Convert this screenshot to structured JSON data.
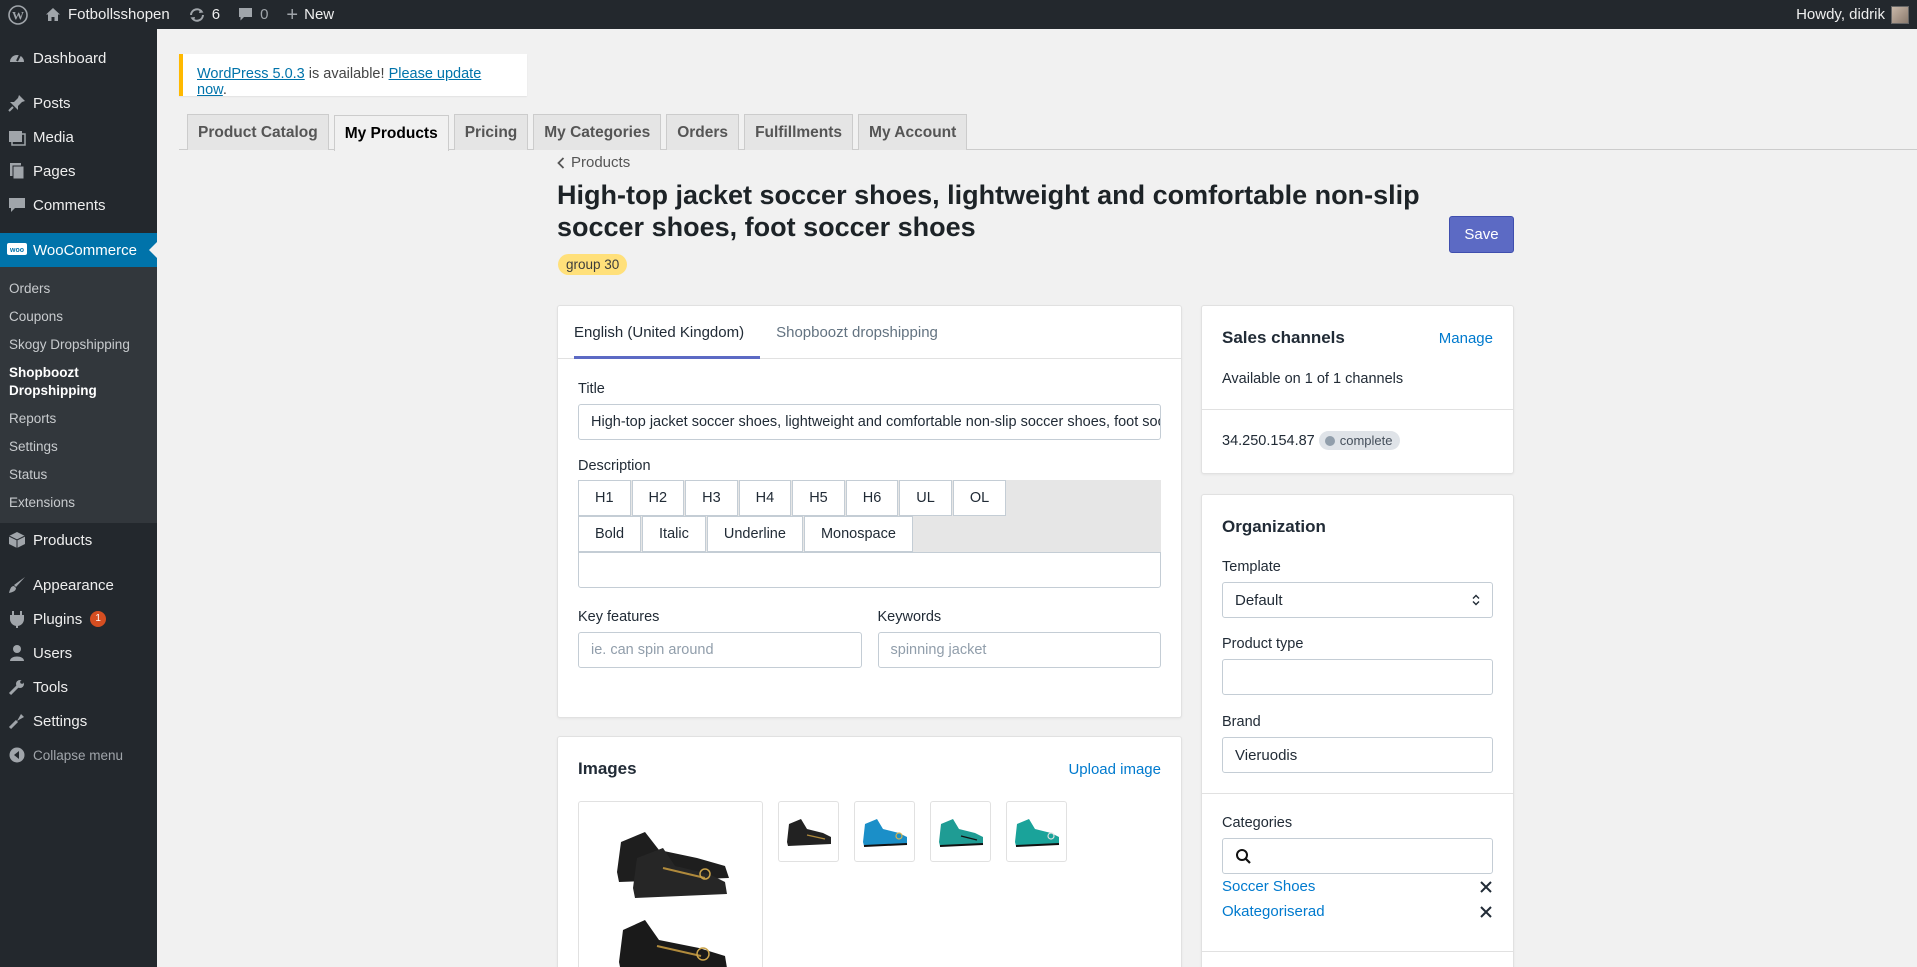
{
  "adminbar": {
    "site_name": "Fotbollsshopen",
    "updates_count": "6",
    "comments_count": "0",
    "new_label": "New",
    "greeting": "Howdy, didrik"
  },
  "sidebar": {
    "items": [
      {
        "label": "Dashboard",
        "icon": "dashboard-icon"
      },
      {
        "label": "Posts",
        "icon": "pin-icon"
      },
      {
        "label": "Media",
        "icon": "media-icon"
      },
      {
        "label": "Pages",
        "icon": "pages-icon"
      },
      {
        "label": "Comments",
        "icon": "comment-icon"
      },
      {
        "label": "WooCommerce",
        "icon": "woo-icon"
      }
    ],
    "woo_submenu": [
      "Orders",
      "Coupons",
      "Skogy Dropshipping",
      "Shopboozt Dropshipping",
      "Reports",
      "Settings",
      "Status",
      "Extensions"
    ],
    "items_after": [
      {
        "label": "Products",
        "icon": "products-icon"
      },
      {
        "label": "Appearance",
        "icon": "brush-icon"
      },
      {
        "label": "Plugins",
        "icon": "plugin-icon",
        "badge": "1"
      },
      {
        "label": "Users",
        "icon": "user-icon"
      },
      {
        "label": "Tools",
        "icon": "wrench-icon"
      },
      {
        "label": "Settings",
        "icon": "settings-icon"
      }
    ],
    "collapse_label": "Collapse menu"
  },
  "notice": {
    "link1": "WordPress 5.0.3",
    "middle": " is available! ",
    "link2": "Please update now",
    "end": "."
  },
  "tabs": [
    "Product Catalog",
    "My Products",
    "Pricing",
    "My Categories",
    "Orders",
    "Fulfillments",
    "My Account"
  ],
  "active_tab": "My Products",
  "breadcrumb": "Products",
  "page_title": "High-top jacket soccer shoes, lightweight and comfortable non-slip soccer shoes, foot soccer shoes",
  "group_badge": "group 30",
  "save_label": "Save",
  "main_card": {
    "tabs": [
      "English (United Kingdom)",
      "Shopboozt dropshipping"
    ],
    "title_label": "Title",
    "title_value": "High-top jacket soccer shoes, lightweight and comfortable non-slip soccer shoes, foot soccer shoes",
    "description_label": "Description",
    "heading_buttons": [
      "H1",
      "H2",
      "H3",
      "H4",
      "H5",
      "H6",
      "UL",
      "OL"
    ],
    "style_buttons": [
      "Bold",
      "Italic",
      "Underline",
      "Monospace"
    ],
    "description_value": "",
    "key_features_label": "Key features",
    "key_features_placeholder": "ie. can spin around",
    "keywords_label": "Keywords",
    "keywords_placeholder": "spinning jacket"
  },
  "images_card": {
    "title": "Images",
    "upload_label": "Upload image",
    "thumb_colors": [
      "#222222",
      "#1b8fc8",
      "#1f9c94",
      "#1aa39a"
    ]
  },
  "sales_card": {
    "title": "Sales channels",
    "manage_label": "Manage",
    "availability": "Available on 1 of 1 channels",
    "channel_ip": "34.250.154.87",
    "channel_status": "complete"
  },
  "org_card": {
    "title": "Organization",
    "template_label": "Template",
    "template_value": "Default",
    "product_type_label": "Product type",
    "product_type_value": "",
    "brand_label": "Brand",
    "brand_value": "Vieruodis",
    "categories_label": "Categories",
    "categories": [
      "Soccer Shoes",
      "Okategoriserad"
    ]
  }
}
